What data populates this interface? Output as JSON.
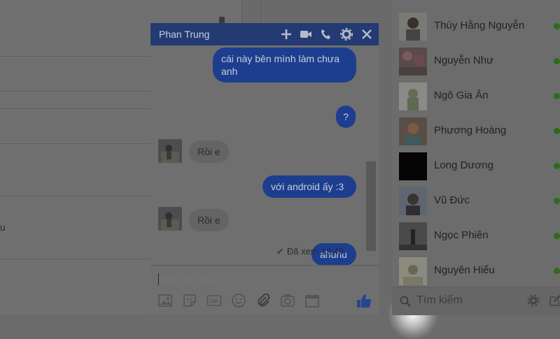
{
  "feed": {
    "snippet": "u"
  },
  "chat": {
    "title": "Phan Trung",
    "messages": [
      {
        "side": "out",
        "text": "cái này bên mình làm chưa anh"
      },
      {
        "side": "out",
        "text": "?"
      },
      {
        "side": "in",
        "text": "Rồi e"
      },
      {
        "side": "out",
        "text": "với android ấy :3"
      },
      {
        "side": "in",
        "text": "Rồi e"
      },
      {
        "side": "out",
        "text": "ahuhu"
      }
    ],
    "seen_status": "Đã xem 12:45",
    "input_placeholder": "Nhập tin nhắn...",
    "colors": {
      "header": "#233a73",
      "bubble_out": "#1d3e8e",
      "bubble_in": "#646464"
    },
    "toolbar_icons": [
      "photo-icon",
      "sticker-icon",
      "gif-icon",
      "emoji-icon",
      "attachment-icon",
      "camera-icon",
      "calendar-icon",
      "like-icon"
    ]
  },
  "contacts": [
    {
      "name": "Thúy Hằng Nguyễn",
      "online": true
    },
    {
      "name": "Nguyễn Như",
      "online": true
    },
    {
      "name": "Ngô Gia Ân",
      "online": true
    },
    {
      "name": "Phương Hoàng",
      "online": true
    },
    {
      "name": "Long Dương",
      "online": true
    },
    {
      "name": "Vũ Đức",
      "online": true
    },
    {
      "name": "Ngọc Phiên",
      "online": true
    },
    {
      "name": "Nguyên Hiểu",
      "online": true
    }
  ],
  "sidebar_search": {
    "placeholder": "Tìm kiếm"
  }
}
